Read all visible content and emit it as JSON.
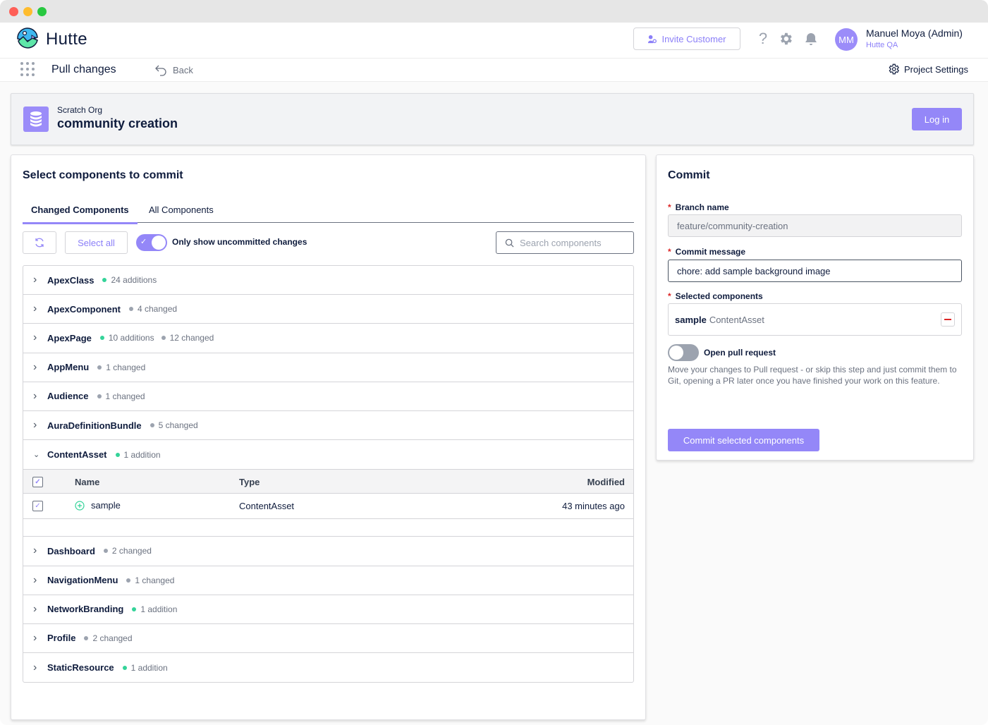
{
  "app": {
    "brand": "Hutte"
  },
  "header": {
    "invite_label": "Invite Customer",
    "user": {
      "initials": "MM",
      "name": "Manuel Moya (Admin)",
      "org": "Hutte QA"
    }
  },
  "subheader": {
    "page_title": "Pull changes",
    "back_label": "Back",
    "project_settings_label": "Project Settings"
  },
  "org": {
    "type": "Scratch Org",
    "name": "community creation",
    "login_label": "Log in"
  },
  "components_panel": {
    "title": "Select components to commit",
    "tabs": [
      {
        "label": "Changed Components",
        "active": true
      },
      {
        "label": "All Components",
        "active": false
      }
    ],
    "select_all_label": "Select all",
    "toggle_label": "Only show uncommitted changes",
    "toggle_on": true,
    "search_placeholder": "Search components",
    "groups": [
      {
        "name": "ApexClass",
        "stats": [
          {
            "kind": "add",
            "text": "24 additions"
          }
        ]
      },
      {
        "name": "ApexComponent",
        "stats": [
          {
            "kind": "chg",
            "text": "4 changed"
          }
        ]
      },
      {
        "name": "ApexPage",
        "stats": [
          {
            "kind": "add",
            "text": "10 additions"
          },
          {
            "kind": "chg",
            "text": "12 changed"
          }
        ]
      },
      {
        "name": "AppMenu",
        "stats": [
          {
            "kind": "chg",
            "text": "1 changed"
          }
        ]
      },
      {
        "name": "Audience",
        "stats": [
          {
            "kind": "chg",
            "text": "1 changed"
          }
        ]
      },
      {
        "name": "AuraDefinitionBundle",
        "stats": [
          {
            "kind": "chg",
            "text": "5 changed"
          }
        ]
      },
      {
        "name": "ContentAsset",
        "expanded": true,
        "stats": [
          {
            "kind": "add",
            "text": "1 addition"
          }
        ]
      },
      {
        "name": "Dashboard",
        "stats": [
          {
            "kind": "chg",
            "text": "2 changed"
          }
        ]
      },
      {
        "name": "NavigationMenu",
        "stats": [
          {
            "kind": "chg",
            "text": "1 changed"
          }
        ]
      },
      {
        "name": "NetworkBranding",
        "stats": [
          {
            "kind": "add",
            "text": "1 addition"
          }
        ]
      },
      {
        "name": "Profile",
        "stats": [
          {
            "kind": "chg",
            "text": "2 changed"
          }
        ]
      },
      {
        "name": "StaticResource",
        "stats": [
          {
            "kind": "add",
            "text": "1 addition"
          }
        ]
      }
    ],
    "table": {
      "headers": {
        "name": "Name",
        "type": "Type",
        "modified": "Modified"
      },
      "rows": [
        {
          "name": "sample",
          "type": "ContentAsset",
          "modified": "43 minutes ago",
          "checked": true
        }
      ]
    }
  },
  "commit_panel": {
    "title": "Commit",
    "branch_label": "Branch name",
    "branch_value": "feature/community-creation",
    "message_label": "Commit message",
    "message_value": "chore: add sample background image",
    "selected_label": "Selected components",
    "selected": [
      {
        "name": "sample",
        "type": "ContentAsset"
      }
    ],
    "pr_label": "Open pull request",
    "pr_on": false,
    "pr_help": "Move your changes to Pull request - or skip this step and just commit them to Git, opening a PR later once you have finished your work on this feature.",
    "commit_button": "Commit selected components"
  },
  "colors": {
    "accent": "#9487f8",
    "addition": "#34d399",
    "changed": "#9ca3af",
    "danger": "#dc2626"
  }
}
